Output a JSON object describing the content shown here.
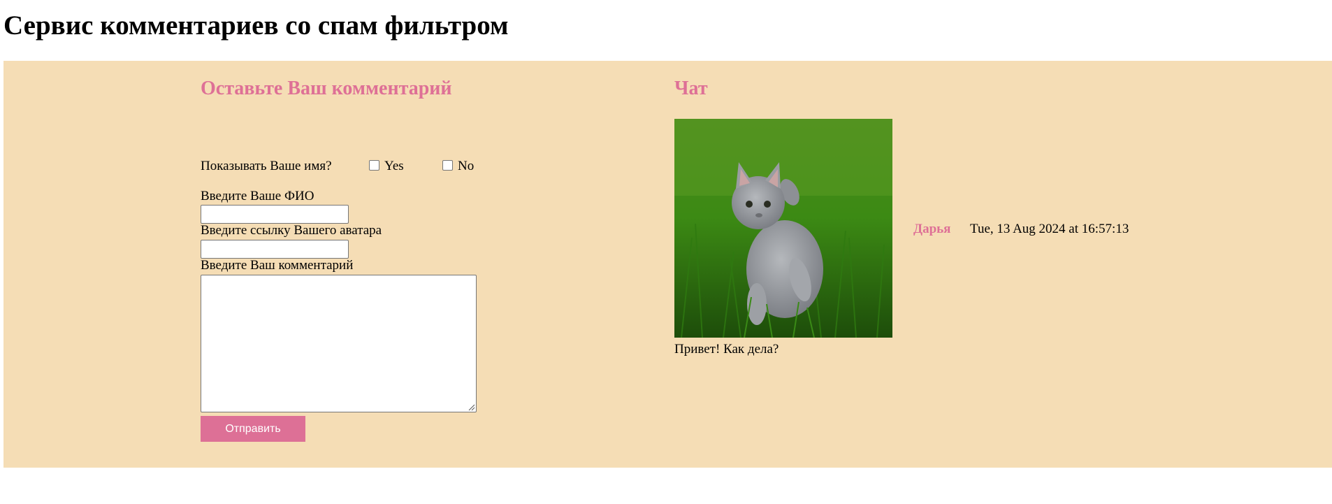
{
  "page": {
    "title": "Сервис комментариев со спам фильтром"
  },
  "colors": {
    "band_background": "#f5ddb5",
    "accent": "#de7096",
    "button_background": "#dd7096"
  },
  "form": {
    "title": "Оставьте Ваш комментарий",
    "show_name_label": "Показывать Ваше имя?",
    "yes_label": "Yes",
    "no_label": "No",
    "fio_label": "Введите Ваше ФИО",
    "fio_value": "",
    "avatar_label": "Введите ссылку Вашего аватара",
    "avatar_value": "",
    "comment_label": "Введите Ваш комментарий",
    "comment_value": "",
    "submit_label": "Отправить"
  },
  "chat": {
    "title": "Чат",
    "messages": [
      {
        "author": "Дарья",
        "timestamp": "Tue, 13 Aug 2024 at 16:57:13",
        "text": "Привет! Как дела?",
        "avatar_icon": "kitten-photo"
      }
    ]
  }
}
